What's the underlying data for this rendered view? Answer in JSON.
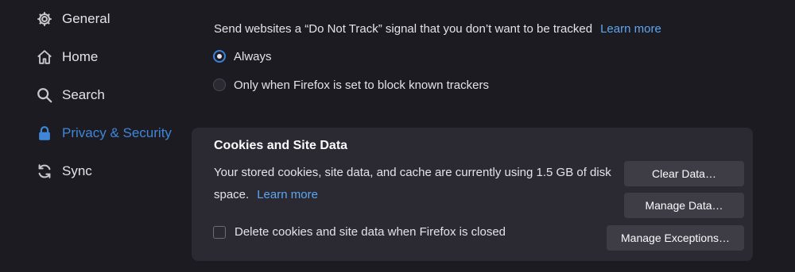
{
  "sidebar": {
    "items": [
      {
        "label": "General",
        "icon": "gear-icon"
      },
      {
        "label": "Home",
        "icon": "home-icon"
      },
      {
        "label": "Search",
        "icon": "search-icon"
      },
      {
        "label": "Privacy & Security",
        "icon": "lock-icon",
        "active": true
      },
      {
        "label": "Sync",
        "icon": "sync-icon"
      }
    ]
  },
  "dnt": {
    "description": "Send websites a “Do Not Track” signal that you don’t want to be tracked",
    "learn_more": "Learn more",
    "options": [
      {
        "label": "Always",
        "selected": true
      },
      {
        "label": "Only when Firefox is set to block known trackers",
        "selected": false
      }
    ]
  },
  "cookies": {
    "title": "Cookies and Site Data",
    "description": "Your stored cookies, site data, and cache are currently using 1.5 GB of disk space.",
    "learn_more": "Learn more",
    "delete_on_close_label": "Delete cookies and site data when Firefox is closed",
    "delete_on_close_checked": false,
    "buttons": {
      "clear": "Clear Data…",
      "manage": "Manage Data…",
      "exceptions": "Manage Exceptions…"
    }
  },
  "colors": {
    "background": "#1c1b22",
    "panel": "#2b2a33",
    "accent": "#3f86d9",
    "link": "#5ea6f0"
  }
}
